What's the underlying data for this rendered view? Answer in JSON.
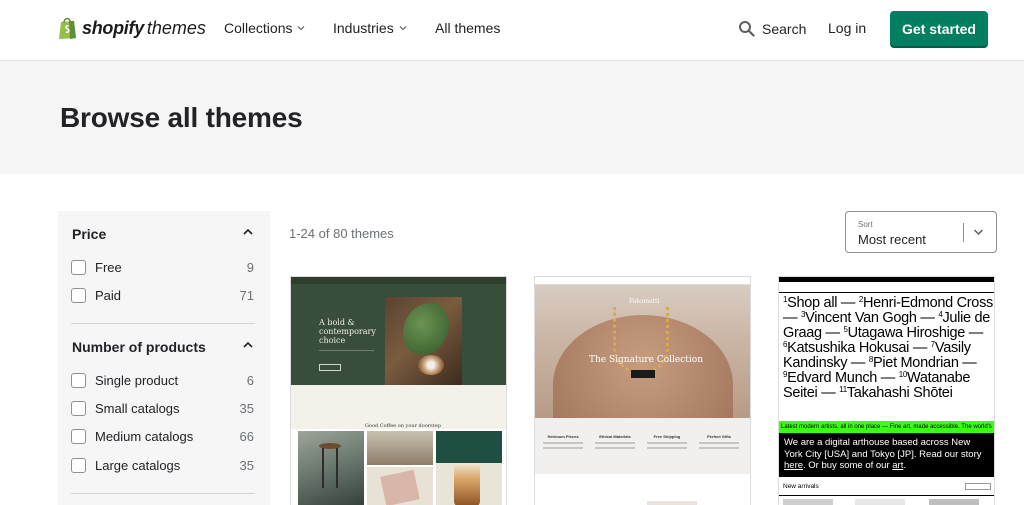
{
  "header": {
    "logo_word": "shopify",
    "logo_suffix": "themes",
    "nav": [
      {
        "label": "Collections"
      },
      {
        "label": "Industries"
      },
      {
        "label": "All themes"
      }
    ],
    "search_label": "Search",
    "login_label": "Log in",
    "cta_label": "Get started"
  },
  "hero": {
    "title": "Browse all themes"
  },
  "filters": {
    "price": {
      "title": "Price",
      "options": [
        {
          "label": "Free",
          "count": "9"
        },
        {
          "label": "Paid",
          "count": "71"
        }
      ]
    },
    "products": {
      "title": "Number of products",
      "options": [
        {
          "label": "Single product",
          "count": "6"
        },
        {
          "label": "Small catalogs",
          "count": "35"
        },
        {
          "label": "Medium catalogs",
          "count": "66"
        },
        {
          "label": "Large catalogs",
          "count": "35"
        }
      ]
    }
  },
  "results": {
    "summary": "1-24 of 80 themes",
    "sort_label": "Sort",
    "sort_value": "Most recent"
  },
  "cards": [
    {
      "headline": "A bold & contemporary choice",
      "section_title": "Good Coffee on your doorstep"
    },
    {
      "brand": "Falconetti",
      "hero_title": "The Signature Collection",
      "features": [
        "Heirloom Pieces",
        "Ethical Materials",
        "Free Shipping",
        "Perfect Gifts"
      ]
    },
    {
      "marquee": "Latest modern artists, all in one place — Fine art, made accessible. The world's",
      "about_pre": "We are a digital arthouse based across New York City [USA] and Tokyo [JP]. Read our story ",
      "about_here": "here",
      "about_mid": ". Or buy some of our ",
      "about_art": "art",
      "about_end": ".",
      "new_arrivals": "New arrivals",
      "artists": [
        {
          "n": "1",
          "name": "Shop all —"
        },
        {
          "n": "2",
          "name": "Henri-Edmond Cross —"
        },
        {
          "n": "3",
          "name": "Vincent Van Gogh —"
        },
        {
          "n": "4",
          "name": "Julie de Graag —"
        },
        {
          "n": "5",
          "name": "Utagawa Hiroshige —"
        },
        {
          "n": "6",
          "name": "Katsushika Hokusai —"
        },
        {
          "n": "7",
          "name": "Vasily Kandinsky —"
        },
        {
          "n": "8",
          "name": "Piet Mondrian —"
        },
        {
          "n": "9",
          "name": "Edvard Munch —"
        },
        {
          "n": "10",
          "name": "Watanabe Seitei —"
        },
        {
          "n": "11",
          "name": "Takahashi Shōtei"
        }
      ]
    }
  ],
  "colors": {
    "brand_green": "#008060",
    "hero_bg": "#f6f6f7",
    "art_accent": "#39ff14"
  }
}
